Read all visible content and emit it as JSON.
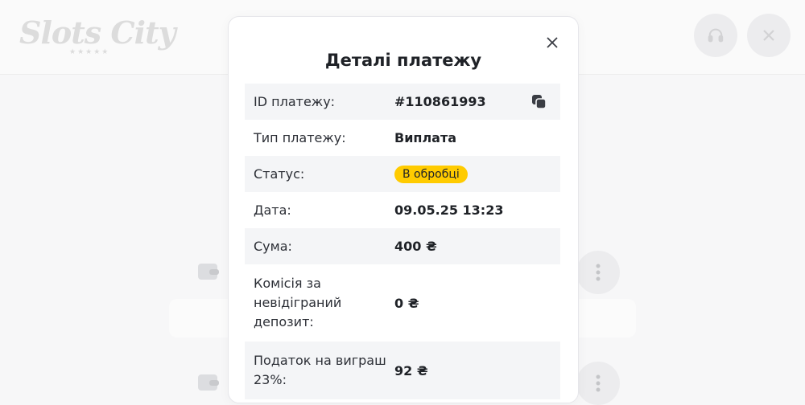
{
  "app": {
    "logo_text": "Slots City"
  },
  "modal": {
    "title": "Деталі платежу",
    "rows": [
      {
        "label": "ID платежу:",
        "value": "#110861993"
      },
      {
        "label": "Тип платежу:",
        "value": "Виплата"
      },
      {
        "label": "Статус:",
        "value": "В обробці"
      },
      {
        "label": "Дата:",
        "value": "09.05.25 13:23"
      },
      {
        "label": "Сума:",
        "value": "400 ₴"
      },
      {
        "label": "Комісія за невідіграний депозит:",
        "value": "0 ₴"
      },
      {
        "label": "Податок на виграш 23%:",
        "value": "92 ₴"
      }
    ]
  },
  "icons": {
    "copy": "copy-icon",
    "close": "close-icon",
    "support": "headset-icon",
    "more": "more-vertical-icon",
    "wallet": "wallet-icon"
  },
  "colors": {
    "status_badge": "#ffcb00",
    "row_shade": "#f4f5f7"
  }
}
